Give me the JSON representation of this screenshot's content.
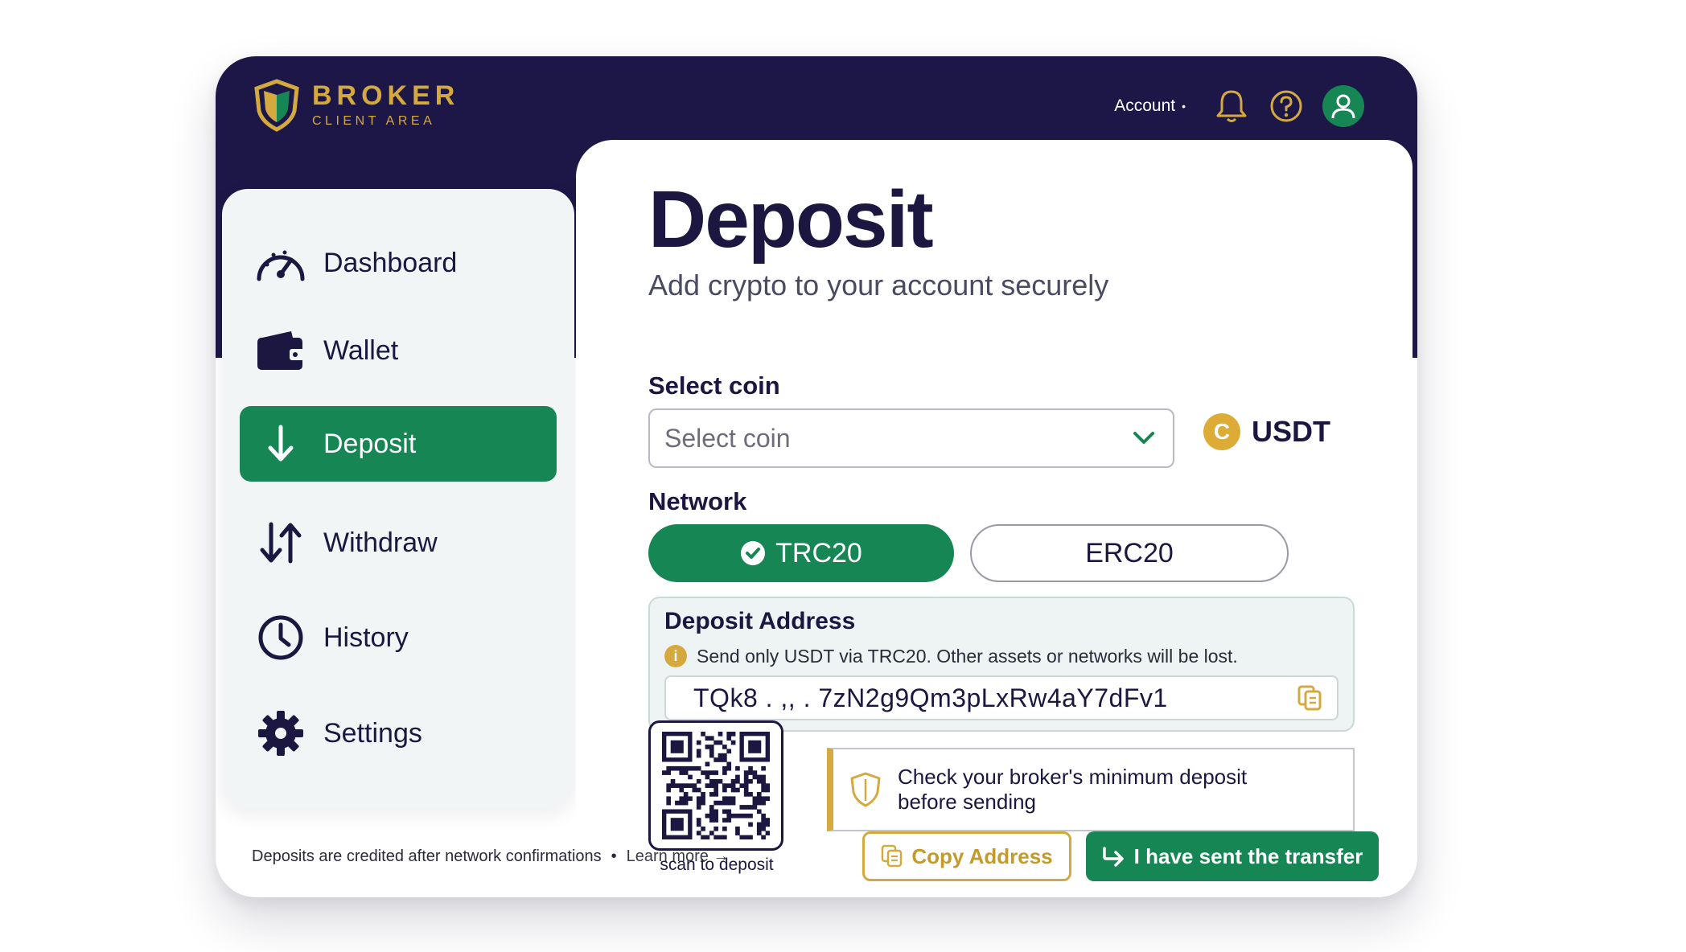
{
  "brand": {
    "name": "BROKER",
    "subtitle": "CLIENT AREA"
  },
  "header": {
    "account_label": "Account",
    "account_dot": "•"
  },
  "sidebar": {
    "items": [
      {
        "label": "Dashboard",
        "icon": "gauge-icon",
        "active": false
      },
      {
        "label": "Wallet",
        "icon": "wallet-icon",
        "active": false
      },
      {
        "label": "Deposit",
        "icon": "arrow-down-icon",
        "active": true
      },
      {
        "label": "Withdraw",
        "icon": "arrows-up-down-icon",
        "active": false
      },
      {
        "label": "History",
        "icon": "clock-icon",
        "active": false
      },
      {
        "label": "Settings",
        "icon": "gear-icon",
        "active": false
      }
    ]
  },
  "page": {
    "title": "Deposit",
    "subtitle": "Add crypto to your account securely"
  },
  "coin": {
    "label": "Select coin",
    "placeholder": "Select coin",
    "selected_symbol": "C",
    "selected_name": "USDT"
  },
  "network": {
    "label": "Network",
    "options": [
      {
        "label": "TRC20",
        "selected": true
      },
      {
        "label": "ERC20",
        "selected": false
      }
    ]
  },
  "address": {
    "title": "Deposit Address",
    "info_symbol": "i",
    "warning": "Send only USDT via TRC20. Other assets or networks will be lost.",
    "value": "TQk8 . ,, . 7zN2g9Qm3pLxRw4aY7dFv1"
  },
  "qr": {
    "caption": "scan to deposit"
  },
  "notice": {
    "text": "Check your broker's minimum deposit before sending"
  },
  "footer": {
    "note": "Deposits are credited after network confirmations",
    "separator": "•",
    "learn_more": "Learn more →"
  },
  "actions": {
    "copy_label": "Copy Address",
    "sent_label": "I have sent the transfer"
  },
  "colors": {
    "navy": "#1d1747",
    "green": "#168754",
    "gold": "#d4a940"
  }
}
